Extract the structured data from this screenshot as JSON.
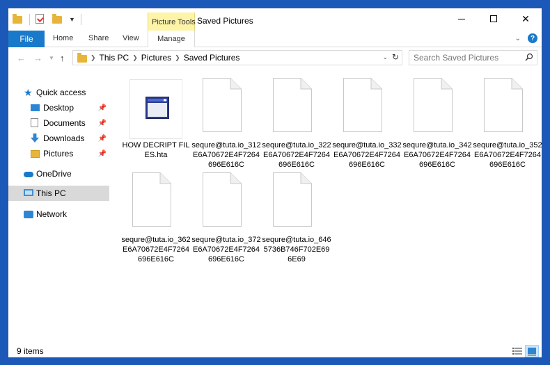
{
  "window": {
    "title": "Saved Pictures",
    "contextual_tab_group": "Picture Tools"
  },
  "ribbon": {
    "tabs": [
      {
        "label": "File"
      },
      {
        "label": "Home"
      },
      {
        "label": "Share"
      },
      {
        "label": "View"
      },
      {
        "label": "Manage"
      }
    ]
  },
  "address": {
    "breadcrumbs": [
      "This PC",
      "Pictures",
      "Saved Pictures"
    ]
  },
  "search": {
    "placeholder": "Search Saved Pictures"
  },
  "nav": {
    "items": [
      {
        "label": "Quick access",
        "icon": "star-icon"
      },
      {
        "label": "Desktop",
        "icon": "desktop-icon",
        "pinned": true
      },
      {
        "label": "Documents",
        "icon": "documents-icon",
        "pinned": true
      },
      {
        "label": "Downloads",
        "icon": "downloads-icon",
        "pinned": true
      },
      {
        "label": "Pictures",
        "icon": "pictures-icon",
        "pinned": true
      },
      {
        "label": "OneDrive",
        "icon": "onedrive-icon"
      },
      {
        "label": "This PC",
        "icon": "this-pc-icon",
        "selected": true
      },
      {
        "label": "Network",
        "icon": "network-icon"
      }
    ]
  },
  "files": [
    {
      "name": "HOW DECRIPT FILES.hta",
      "type": "hta"
    },
    {
      "name": "sequre@tuta.io_312E6A70672E4F7264696E616C",
      "type": "generic"
    },
    {
      "name": "sequre@tuta.io_322E6A70672E4F7264696E616C",
      "type": "generic"
    },
    {
      "name": "sequre@tuta.io_332E6A70672E4F7264696E616C",
      "type": "generic"
    },
    {
      "name": "sequre@tuta.io_342E6A70672E4F7264696E616C",
      "type": "generic"
    },
    {
      "name": "sequre@tuta.io_352E6A70672E4F7264696E616C",
      "type": "generic"
    },
    {
      "name": "sequre@tuta.io_362E6A70672E4F7264696E616C",
      "type": "generic"
    },
    {
      "name": "sequre@tuta.io_372E6A70672E4F7264696E616C",
      "type": "generic"
    },
    {
      "name": "sequre@tuta.io_6465736B746F702E696E69",
      "type": "generic"
    }
  ],
  "status": {
    "item_count": "9 items"
  },
  "colors": {
    "accent": "#1979ca",
    "contextual_tab": "#fdf4a8",
    "selection": "#d9d9d9"
  }
}
